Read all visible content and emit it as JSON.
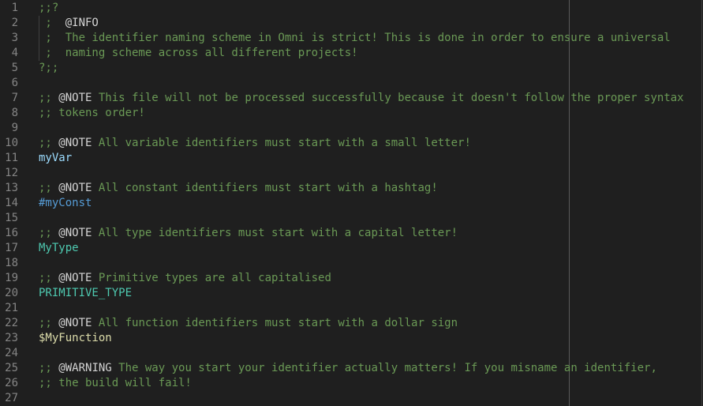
{
  "editor": {
    "line_numbers": [
      "1",
      "2",
      "3",
      "4",
      "5",
      "6",
      "7",
      "8",
      "9",
      "10",
      "11",
      "12",
      "13",
      "14",
      "15",
      "16",
      "17",
      "18",
      "19",
      "20",
      "21",
      "22",
      "23",
      "24",
      "25",
      "26",
      "27"
    ],
    "lines": {
      "l1": ";;?",
      "l2_prefix": " ;  ",
      "l2_tag": "@INFO",
      "l3": " ;  The identifier naming scheme in Omni is strict! This is done in order to ensure a universal",
      "l4": " ;  naming scheme across all different projects!",
      "l5": "?;;",
      "l7_prefix": ";; ",
      "l7_tag": "@NOTE",
      "l7_text": " This file will not be processed successfully because it doesn't follow the proper syntax",
      "l8": ";; tokens order!",
      "l10_prefix": ";; ",
      "l10_tag": "@NOTE",
      "l10_text": " All variable identifiers must start with a small letter!",
      "l11": "myVar",
      "l13_prefix": ";; ",
      "l13_tag": "@NOTE",
      "l13_text": " All constant identifiers must start with a hashtag!",
      "l14": "#myConst",
      "l16_prefix": ";; ",
      "l16_tag": "@NOTE",
      "l16_text": " All type identifiers must start with a capital letter!",
      "l17": "MyType",
      "l19_prefix": ";; ",
      "l19_tag": "@NOTE",
      "l19_text": " Primitive types are all capitalised",
      "l20": "PRIMITIVE_TYPE",
      "l22_prefix": ";; ",
      "l22_tag": "@NOTE",
      "l22_text": " All function identifiers must start with a dollar sign",
      "l23": "$MyFunction",
      "l25_prefix": ";; ",
      "l25_tag": "@WARNING",
      "l25_text": " The way you start your identifier actually matters! If you misname an identifier,",
      "l26": ";; the build will fail!"
    }
  },
  "colors": {
    "background": "#1f1f1f",
    "line_number": "#858585",
    "comment": "#6a9955",
    "tag": "#d4d4d4",
    "variable": "#9cdcfe",
    "constant": "#569cd6",
    "type": "#4ec9b0",
    "function": "#dcdcaa"
  }
}
